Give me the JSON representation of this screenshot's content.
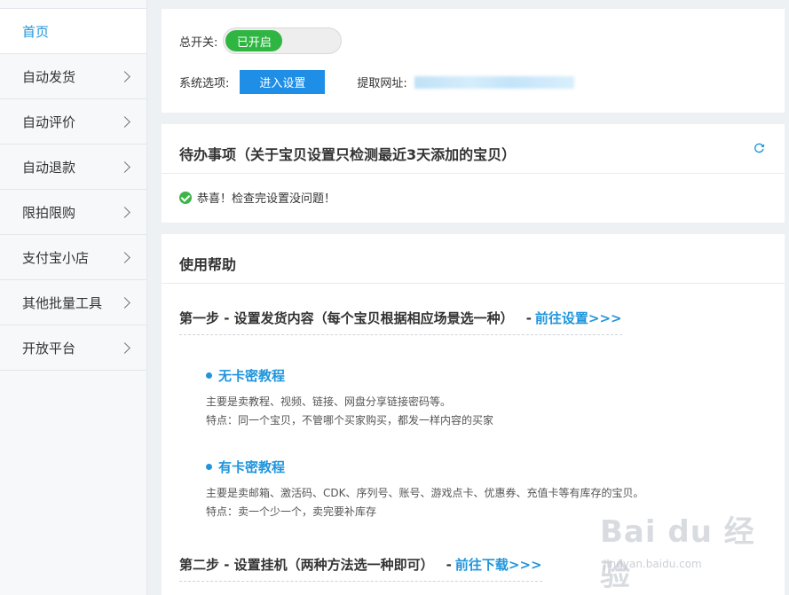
{
  "sidebar": {
    "items": [
      {
        "label": "首页",
        "active": true,
        "chevron": false
      },
      {
        "label": "自动发货",
        "active": false,
        "chevron": true
      },
      {
        "label": "自动评价",
        "active": false,
        "chevron": true
      },
      {
        "label": "自动退款",
        "active": false,
        "chevron": true
      },
      {
        "label": "限拍限购",
        "active": false,
        "chevron": true
      },
      {
        "label": "支付宝小店",
        "active": false,
        "chevron": true
      },
      {
        "label": "其他批量工具",
        "active": false,
        "chevron": true
      },
      {
        "label": "开放平台",
        "active": false,
        "chevron": true
      }
    ]
  },
  "master": {
    "label": "总开关:",
    "toggle_text": "已开启",
    "system_label": "系统选项:",
    "settings_button": "进入设置",
    "pickup_label": "提取网址:"
  },
  "todo": {
    "title": "待办事项（关于宝贝设置只检测最近3天添加的宝贝）",
    "ok_message": "恭喜！检查完设置没问题！"
  },
  "help": {
    "title": "使用帮助",
    "step1": {
      "text": "第一步 - 设置发货内容（每个宝贝根据相应场景选一种）",
      "dash": "-",
      "link": "前往设置>>>"
    },
    "no_card": {
      "title": "无卡密教程",
      "line1": "主要是卖教程、视频、链接、网盘分享链接密码等。",
      "line2": "特点：同一个宝贝，不管哪个买家购买，都发一样内容的买家"
    },
    "card": {
      "title": "有卡密教程",
      "line1": "主要是卖邮箱、激活码、CDK、序列号、账号、游戏点卡、优惠券、充值卡等有库存的宝贝。",
      "line2": "特点：卖一个少一个，卖完要补库存"
    },
    "step2": {
      "text": "第二步 - 设置挂机（两种方法选一种即可）",
      "dash": "-",
      "link": "前往下载>>>"
    }
  },
  "watermark": {
    "main": "Bai du 经验",
    "sub": "jingyan.baidu.com"
  },
  "colors": {
    "accent": "#1f95dc",
    "toggle_on": "#2fb642",
    "button": "#1f8ee6",
    "success": "#3db449"
  }
}
